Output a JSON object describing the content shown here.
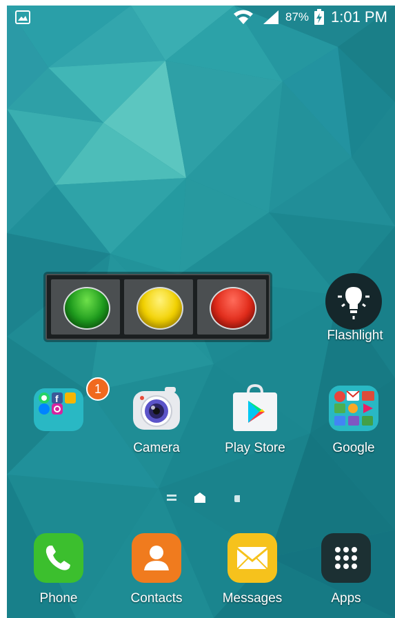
{
  "status_bar": {
    "notification_icon": "image-icon",
    "wifi_icon": "wifi-icon",
    "signal_icon": "signal-icon",
    "battery_percent": "87%",
    "battery_icon": "battery-charging-icon",
    "time": "1:01 PM"
  },
  "widget": {
    "lights": [
      {
        "name": "green-light",
        "color": "#1d9a1d"
      },
      {
        "name": "yellow-light",
        "color": "#f2d100"
      },
      {
        "name": "red-light",
        "color": "#e12b1a"
      }
    ]
  },
  "flashlight": {
    "label": "Flashlight",
    "icon": "lightbulb-icon"
  },
  "home_apps": [
    {
      "label": "",
      "icon": "social-folder-icon",
      "badge": "1"
    },
    {
      "label": "Camera",
      "icon": "camera-icon"
    },
    {
      "label": "Play Store",
      "icon": "play-store-icon"
    },
    {
      "label": "Google",
      "icon": "google-folder-icon"
    }
  ],
  "page_indicator": {
    "pages": [
      "menu",
      "home",
      "page"
    ],
    "active": 1
  },
  "dock": [
    {
      "label": "Phone",
      "icon": "phone-icon"
    },
    {
      "label": "Contacts",
      "icon": "contacts-icon"
    },
    {
      "label": "Messages",
      "icon": "messages-icon"
    },
    {
      "label": "Apps",
      "icon": "apps-grid-icon"
    }
  ],
  "colors": {
    "wallpaper_base": "#1f8c96",
    "phone_green": "#3cbf2e",
    "contacts_orange": "#f07b1e",
    "messages_yellow": "#f6c21c",
    "badge_orange": "#f0691e"
  }
}
